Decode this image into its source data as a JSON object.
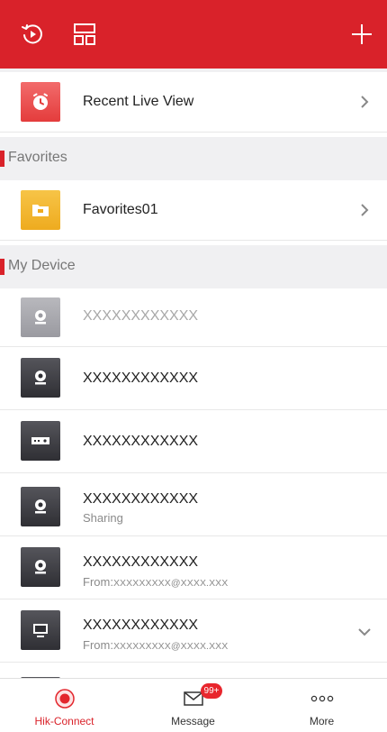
{
  "colors": {
    "brand": "#d9222a",
    "text": "#222222",
    "muted": "#8a8a8a",
    "section_bg": "#f0f0f2",
    "favorites_tile": "#f0b429"
  },
  "header": {
    "left_icons": [
      "history-icon",
      "layout-icon"
    ],
    "right_icon": "plus-icon"
  },
  "recent": {
    "label": "Recent Live View",
    "icon": "clock-icon"
  },
  "favorites": {
    "section_title": "Favorites",
    "items": [
      {
        "label": "Favorites01",
        "icon": "folder-icon"
      }
    ]
  },
  "devices": {
    "section_title": "My Device",
    "items": [
      {
        "name": "XXXXXXXXXXXX",
        "icon": "camera-icon",
        "offline": true
      },
      {
        "name": "XXXXXXXXXXXX",
        "icon": "camera-icon"
      },
      {
        "name": "XXXXXXXXXXXX",
        "icon": "recorder-icon"
      },
      {
        "name": "XXXXXXXXXXXX",
        "sub": "Sharing",
        "icon": "camera-icon"
      },
      {
        "name": "XXXXXXXXXXXX",
        "sub_prefix": "From:",
        "sub_email": "XXXXXXXXX@XXXX.XXX",
        "icon": "camera-icon"
      },
      {
        "name": "XXXXXXXXXXXX",
        "sub_prefix": "From:",
        "sub_email": "XXXXXXXXX@XXXX.XXX",
        "icon": "monitor-icon",
        "expandable": true
      }
    ]
  },
  "tabs": [
    {
      "label": "Hik-Connect",
      "icon": "hik-connect-icon",
      "active": true
    },
    {
      "label": "Message",
      "icon": "envelope-icon",
      "badge": "99+"
    },
    {
      "label": "More",
      "icon": "more-dots-icon"
    }
  ]
}
